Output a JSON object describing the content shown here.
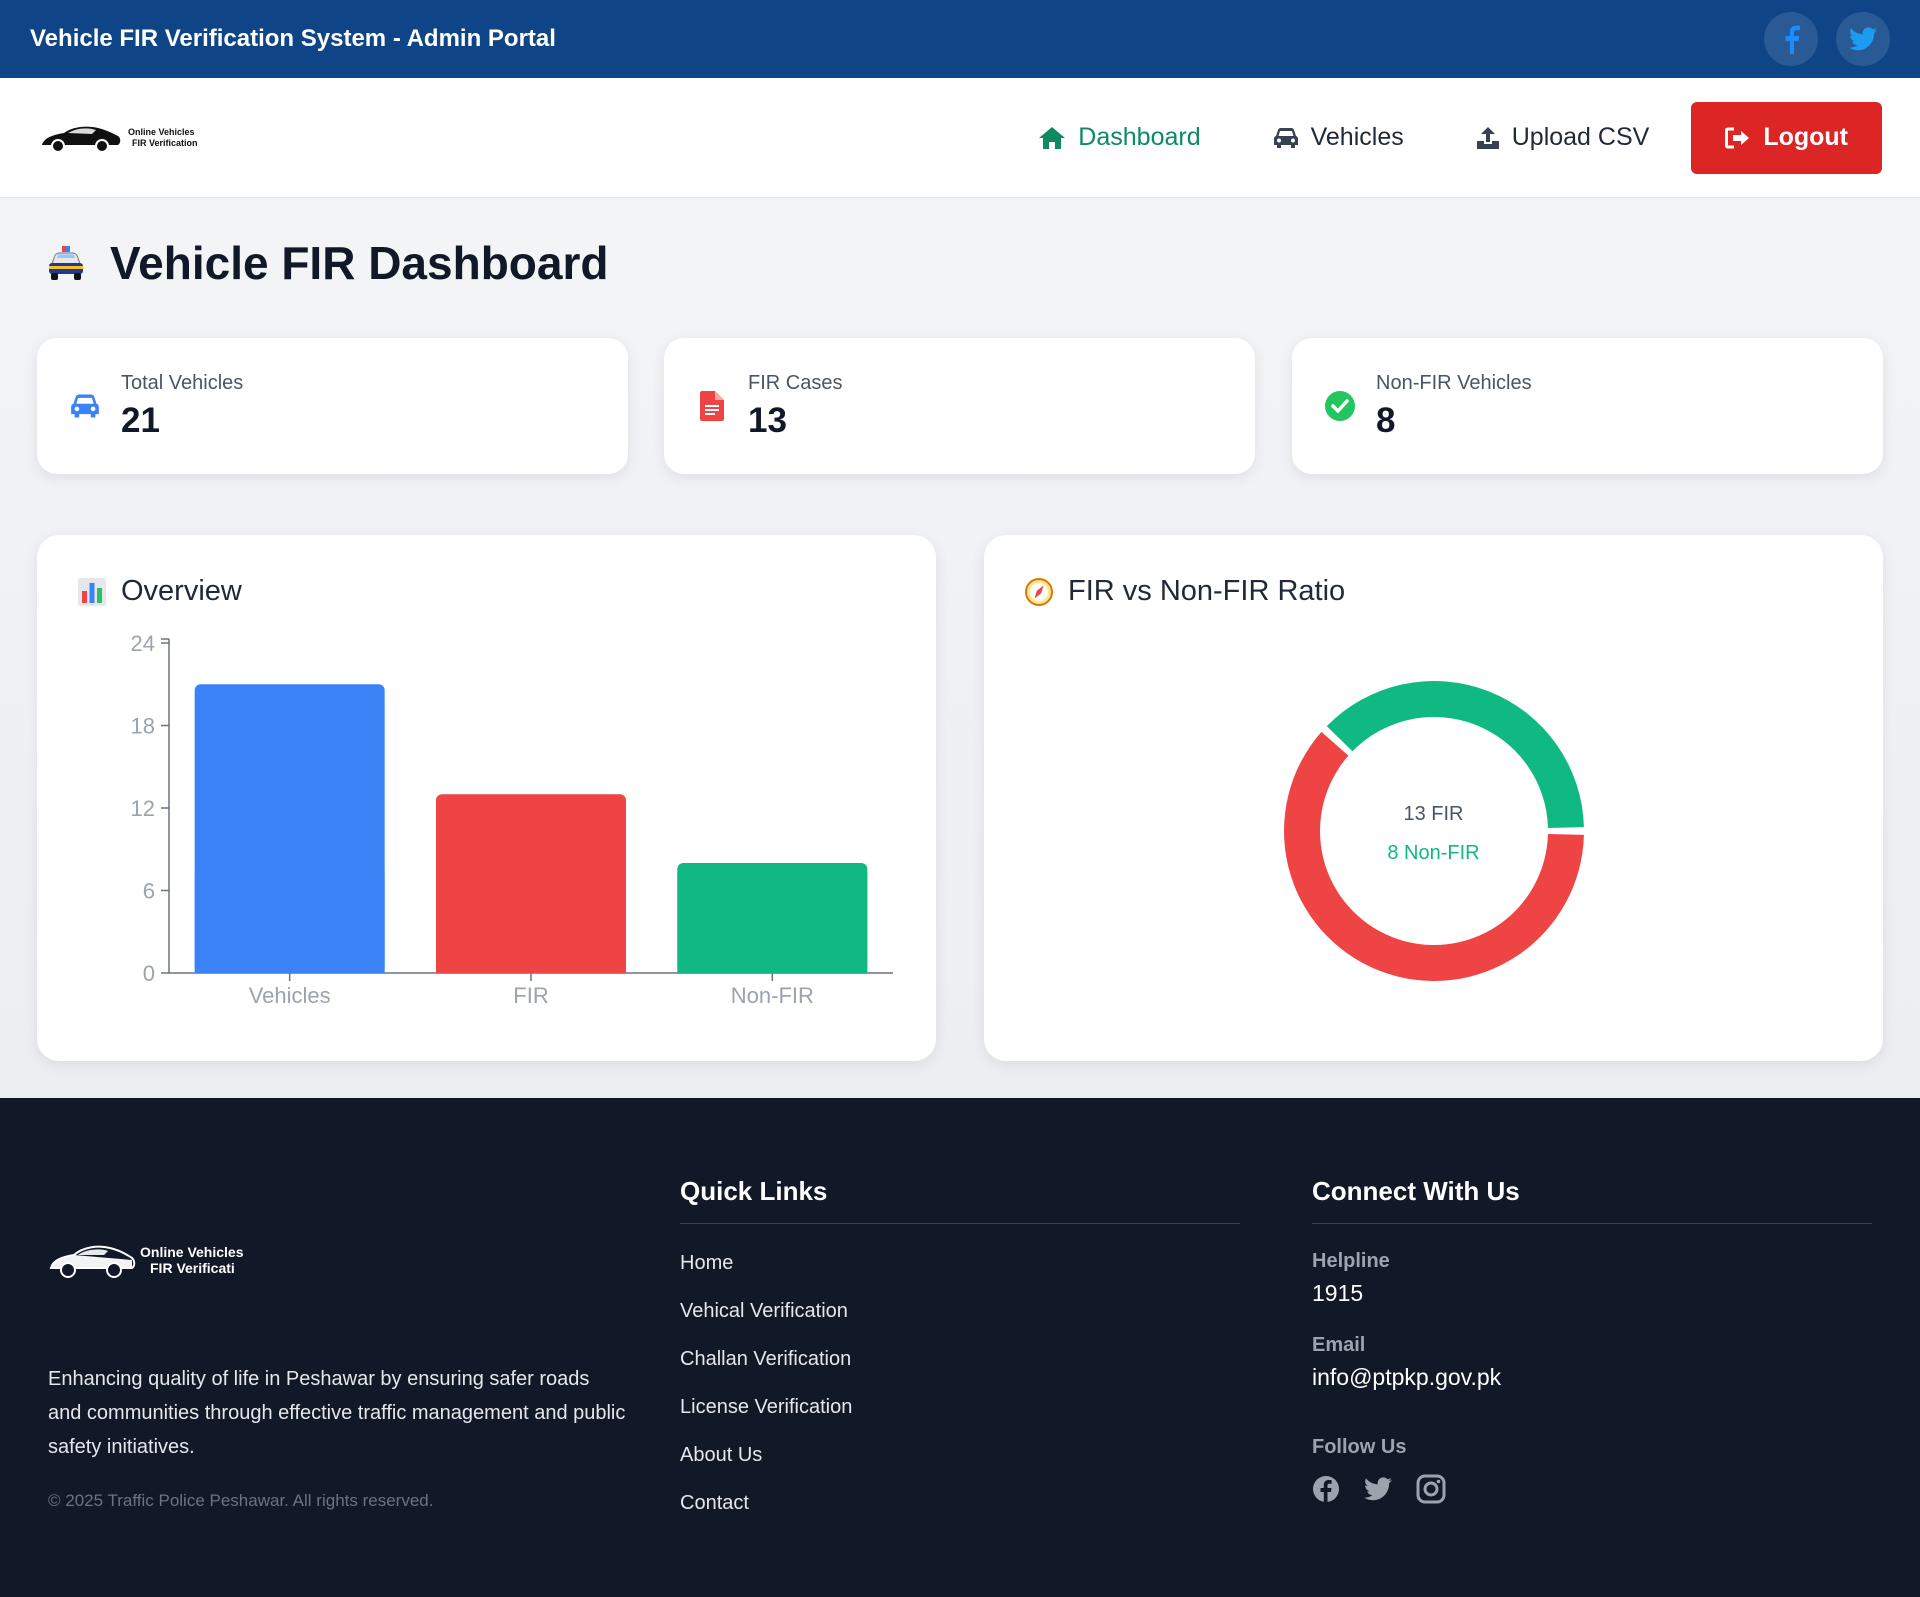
{
  "topbar": {
    "title": "Vehicle FIR Verification System - Admin Portal"
  },
  "brand": {
    "line1": "Online Vehicles",
    "line2": "FIR Verification"
  },
  "nav": {
    "dashboard": "Dashboard",
    "vehicles": "Vehicles",
    "upload": "Upload CSV",
    "logout": "Logout"
  },
  "page": {
    "title": "Vehicle FIR Dashboard"
  },
  "stats": [
    {
      "label": "Total Vehicles",
      "value": "21",
      "icon": "car-icon",
      "color": "#3b82f6"
    },
    {
      "label": "FIR Cases",
      "value": "13",
      "icon": "file-icon",
      "color": "#ef4444"
    },
    {
      "label": "Non-FIR Vehicles",
      "value": "8",
      "icon": "check-circle-icon",
      "color": "#22c55e"
    }
  ],
  "overview": {
    "title": "Overview"
  },
  "ratio": {
    "title": "FIR vs Non-FIR Ratio",
    "fir_label": "13 FIR",
    "nonfir_label": "8 Non-FIR"
  },
  "chart_data": [
    {
      "type": "bar",
      "categories": [
        "Vehicles",
        "FIR",
        "Non-FIR"
      ],
      "values": [
        21,
        13,
        8
      ],
      "colors": [
        "#3b82f6",
        "#ef4444",
        "#10b981"
      ],
      "yticks": [
        "0",
        "6",
        "12",
        "18",
        "24"
      ],
      "ylim": [
        0,
        24
      ]
    },
    {
      "type": "pie",
      "categories": [
        "FIR",
        "Non-FIR"
      ],
      "values": [
        13,
        8
      ],
      "colors": [
        "#ef4444",
        "#10b981"
      ]
    }
  ],
  "footer": {
    "brand_line1": "Online Vehicles",
    "brand_line2": "FIR Verificatio",
    "description": "Enhancing quality of life in Peshawar by ensuring safer roads and communities through effective traffic management and public safety initiatives.",
    "copyright": "© 2025 Traffic Police Peshawar. All rights reserved.",
    "quick_links_title": "Quick Links",
    "links": [
      "Home",
      "Vehical Verification",
      "Challan Verification",
      "License Verification",
      "About Us",
      "Contact"
    ],
    "connect_title": "Connect With Us",
    "helpline_label": "Helpline",
    "helpline": "1915",
    "email_label": "Email",
    "email": "info@ptpkp.gov.pk",
    "follow_label": "Follow Us"
  },
  "colors": {
    "topbar": "#0f4586",
    "accent": "#0e8a5f",
    "logout": "#dc2626",
    "footer": "#111827"
  }
}
